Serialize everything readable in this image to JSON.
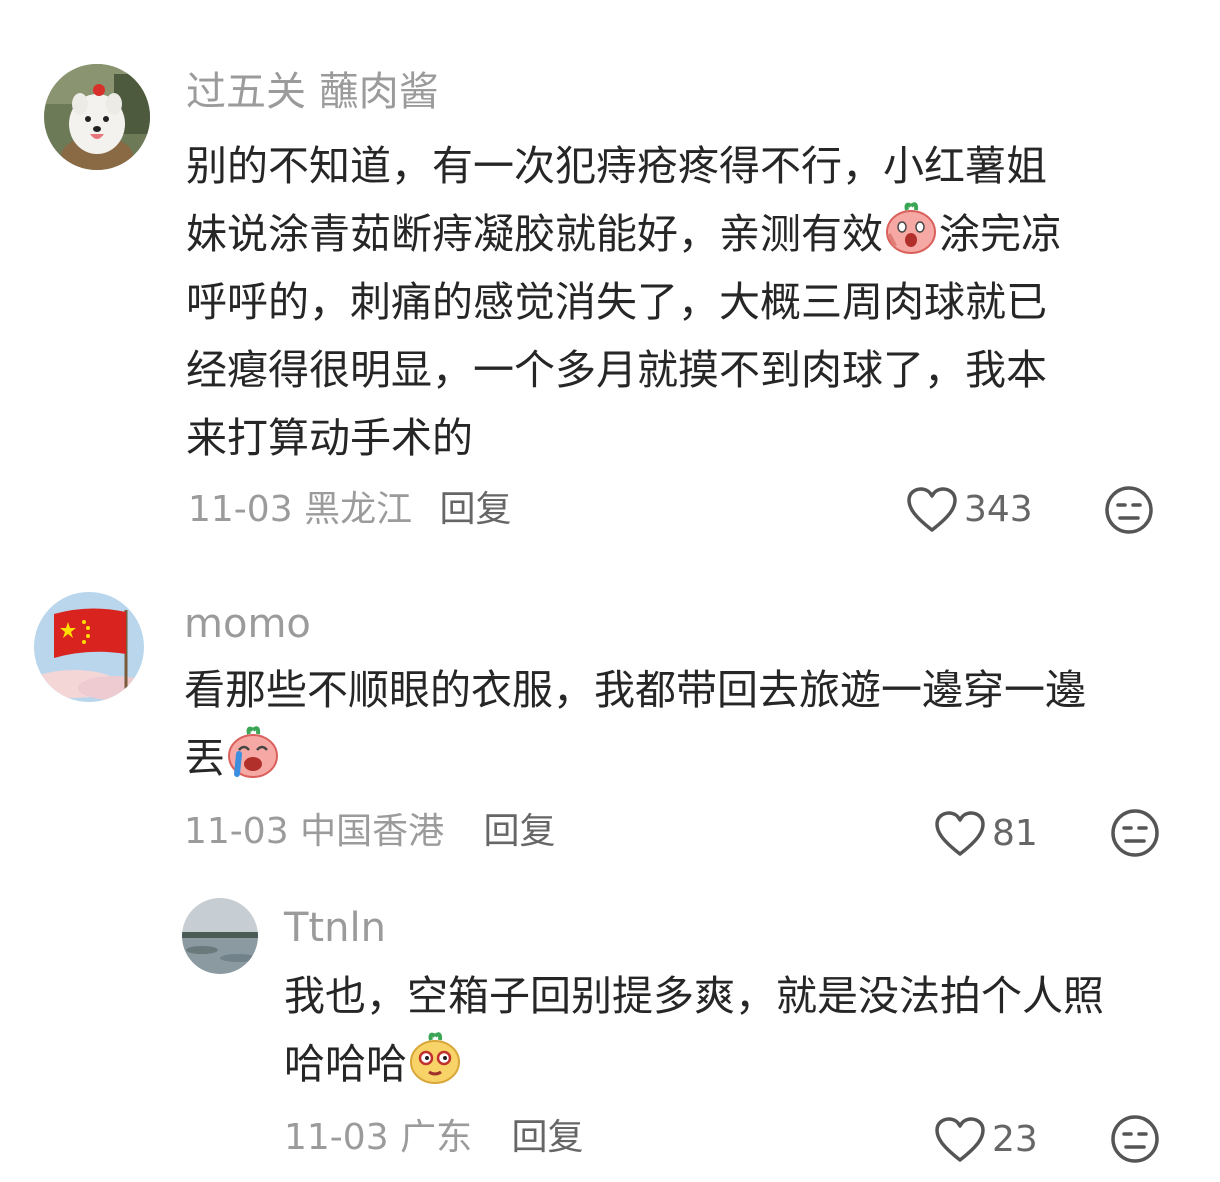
{
  "comments": [
    {
      "username": "过五关 蘸肉酱",
      "lines": [
        "别的不知道，有一次犯痔疮疼得不行，小红薯姐",
        "妹说涂青茹断痔凝胶就能好，亲测有效",
        "涂完凉",
        "呼呼的，刺痛的感觉消失了，大概三周肉球就已",
        "经瘪得很明显，一个多月就摸不到肉球了，我本",
        "来打算动手术的"
      ],
      "date": "11-03",
      "location": "黑龙江",
      "reply_label": "回复",
      "likes": "343",
      "avatar_icon": "samoyed-dog-avatar",
      "inline_emoji": "shocked-face-emoji"
    },
    {
      "username": "momo",
      "lines": [
        "看那些不顺眼的衣服，我都带回去旅遊一邊穿一邊",
        "丟"
      ],
      "date": "11-03",
      "location": "中国香港",
      "reply_label": "回复",
      "likes": "81",
      "avatar_icon": "red-flag-avatar",
      "inline_emoji": "crying-laugh-emoji"
    },
    {
      "username": "Ttnln",
      "lines": [
        "我也，空箱子回别提多爽，就是没法拍个人照",
        "哈哈哈"
      ],
      "date": "11-03",
      "location": "广东",
      "reply_label": "回复",
      "likes": "23",
      "avatar_icon": "lake-landscape-avatar",
      "inline_emoji": "smug-face-emoji"
    }
  ],
  "colors": {
    "username": "#9b9b9b",
    "body": "#262626",
    "meta": "#9b9b9b",
    "icon": "#555555"
  }
}
